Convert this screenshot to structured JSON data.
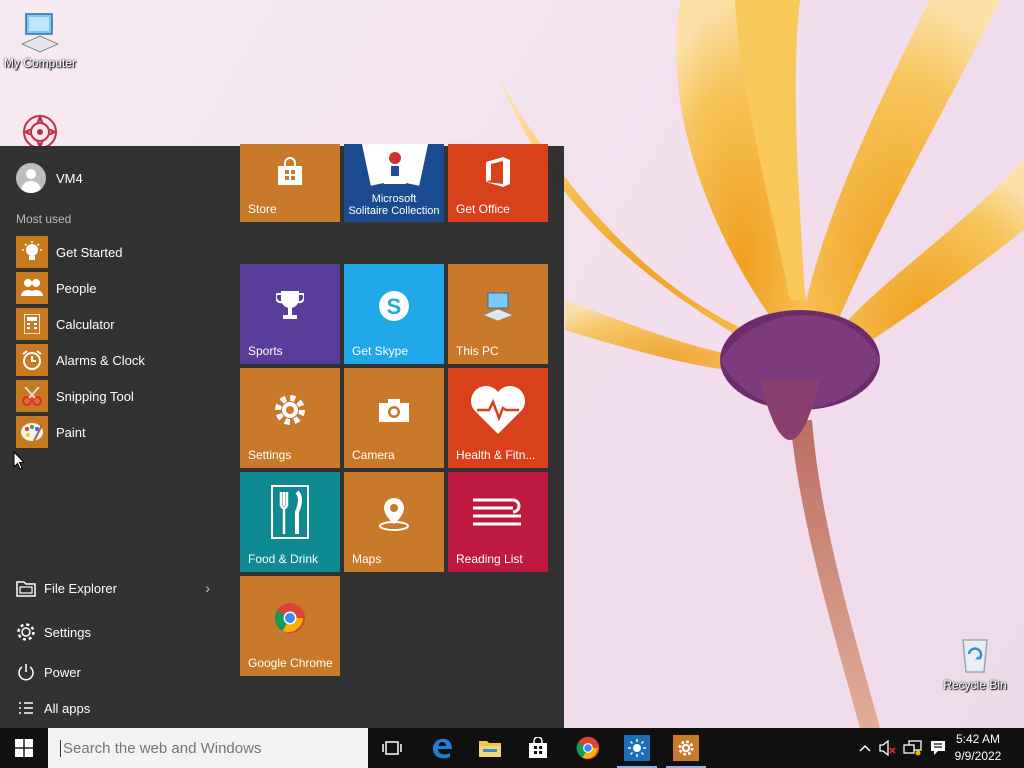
{
  "desktop": {
    "icons": [
      {
        "label": "My Computer",
        "icon": "monitor-icon"
      },
      {
        "label": "",
        "icon": "mandala-icon"
      },
      {
        "label": "Recycle Bin",
        "icon": "recycle-bin-icon"
      }
    ]
  },
  "start_menu": {
    "user_name": "VM4",
    "most_used_label": "Most used",
    "most_used": [
      {
        "label": "Get Started",
        "icon": "lightbulb-icon"
      },
      {
        "label": "People",
        "icon": "people-icon"
      },
      {
        "label": "Calculator",
        "icon": "calculator-icon"
      },
      {
        "label": "Alarms & Clock",
        "icon": "alarm-clock-icon"
      },
      {
        "label": "Snipping Tool",
        "icon": "scissors-icon"
      },
      {
        "label": "Paint",
        "icon": "palette-icon"
      }
    ],
    "bottom": {
      "file_explorer": "File Explorer",
      "settings": "Settings",
      "power": "Power",
      "all_apps": "All apps"
    },
    "tiles": {
      "store": "Store",
      "solitaire_line1": "Microsoft",
      "solitaire_line2": "Solitaire Collection",
      "get_office": "Get Office",
      "sports": "Sports",
      "get_skype": "Get Skype",
      "this_pc": "This PC",
      "settings": "Settings",
      "camera": "Camera",
      "health": "Health & Fitn...",
      "food": "Food & Drink",
      "maps": "Maps",
      "reading_list": "Reading List",
      "chrome": "Google Chrome"
    }
  },
  "taskbar": {
    "search_placeholder": "Search the web and Windows",
    "time": "5:42 AM",
    "date": "9/9/2022"
  },
  "colors": {
    "tile_orange": "#c9792a",
    "tile_purple": "#5a3c9a",
    "tile_blue": "#20a8e8",
    "tile_red": "#d9401c",
    "tile_teal": "#0f8a92",
    "tile_crimson": "#c0193f",
    "menu_bg": "#2b2b2b",
    "taskbar_bg": "#101010"
  }
}
